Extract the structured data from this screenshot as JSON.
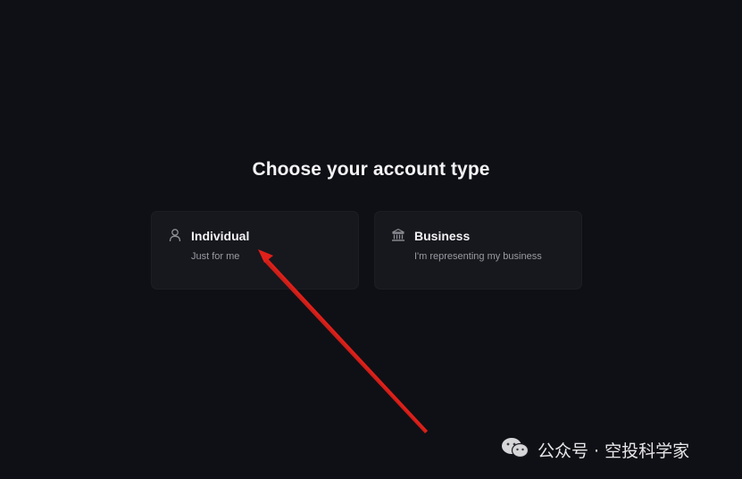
{
  "page": {
    "title": "Choose your account type"
  },
  "options": [
    {
      "label": "Individual",
      "description": "Just for me",
      "icon": "user-icon"
    },
    {
      "label": "Business",
      "description": "I'm representing my business",
      "icon": "bank-icon"
    }
  ],
  "watermark": {
    "text": "公众号 · 空投科学家",
    "icon": "wechat-icon"
  },
  "colors": {
    "background": "#0f1015",
    "card": "#17181d",
    "annotation_arrow": "#e0201a"
  }
}
